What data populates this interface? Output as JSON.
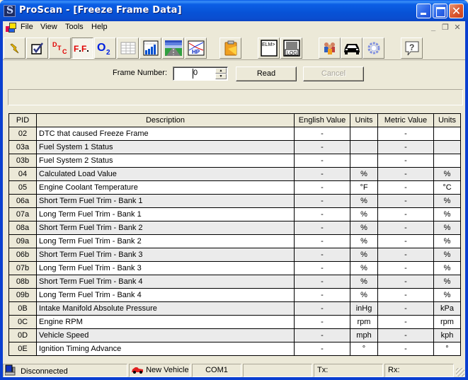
{
  "window": {
    "title": "ProScan - [Freeze Frame Data]",
    "controls": {
      "minimize": "minimize",
      "maximize": "maximize",
      "close": "✕"
    }
  },
  "menu": {
    "items": [
      "File",
      "View",
      "Tools",
      "Help"
    ],
    "mdi_controls": [
      "_",
      "❐",
      "✕"
    ]
  },
  "toolbar": {
    "buttons": [
      {
        "name": "connect",
        "icon": "lightning-icon"
      },
      {
        "name": "diagnostic-check",
        "icon": "checkbox-icon"
      },
      {
        "name": "dtc",
        "icon": "dtc-icon",
        "label": "DTC"
      },
      {
        "name": "freeze-frame",
        "icon": "ff-icon",
        "label": "F.F.",
        "pressed": true
      },
      {
        "name": "o2-sensors",
        "icon": "o2-icon",
        "label": "O2"
      },
      {
        "name": "data-grid",
        "icon": "table-icon"
      },
      {
        "name": "graph",
        "icon": "bar-chart-icon"
      },
      {
        "name": "dashboard",
        "icon": "road-icon"
      },
      {
        "name": "horsepower",
        "icon": "hp-icon",
        "label": "HP"
      },
      {
        "name": "report",
        "icon": "clipboard-icon"
      },
      {
        "name": "elm-terminal",
        "icon": "elm-terminal-icon",
        "label": "ELM>"
      },
      {
        "name": "log",
        "icon": "log-icon",
        "label": "LOG"
      },
      {
        "name": "users",
        "icon": "people-icon"
      },
      {
        "name": "vehicle",
        "icon": "car-icon"
      },
      {
        "name": "settings",
        "icon": "gear-icon"
      },
      {
        "name": "help",
        "icon": "help-icon",
        "label": "?"
      }
    ]
  },
  "frame": {
    "label": "Frame Number:",
    "value": "0",
    "read_label": "Read",
    "cancel_label": "Cancel"
  },
  "table": {
    "columns": [
      "PID",
      "Description",
      "English Value",
      "Units",
      "Metric Value",
      "Units"
    ],
    "rows": [
      {
        "pid": "02",
        "desc": "DTC that caused Freeze Frame",
        "eng": "-",
        "eu": "",
        "met": "-",
        "mu": ""
      },
      {
        "pid": "03a",
        "desc": "Fuel System 1 Status",
        "eng": "-",
        "eu": "",
        "met": "-",
        "mu": ""
      },
      {
        "pid": "03b",
        "desc": "Fuel System 2 Status",
        "eng": "-",
        "eu": "",
        "met": "-",
        "mu": ""
      },
      {
        "pid": "04",
        "desc": "Calculated Load Value",
        "eng": "-",
        "eu": "%",
        "met": "-",
        "mu": "%"
      },
      {
        "pid": "05",
        "desc": "Engine Coolant Temperature",
        "eng": "-",
        "eu": "°F",
        "met": "-",
        "mu": "°C"
      },
      {
        "pid": "06a",
        "desc": "Short Term Fuel Trim - Bank 1",
        "eng": "-",
        "eu": "%",
        "met": "-",
        "mu": "%"
      },
      {
        "pid": "07a",
        "desc": "Long Term Fuel Trim - Bank 1",
        "eng": "-",
        "eu": "%",
        "met": "-",
        "mu": "%"
      },
      {
        "pid": "08a",
        "desc": "Short Term Fuel Trim - Bank 2",
        "eng": "-",
        "eu": "%",
        "met": "-",
        "mu": "%"
      },
      {
        "pid": "09a",
        "desc": "Long Term Fuel Trim - Bank 2",
        "eng": "-",
        "eu": "%",
        "met": "-",
        "mu": "%"
      },
      {
        "pid": "06b",
        "desc": "Short Term Fuel Trim - Bank 3",
        "eng": "-",
        "eu": "%",
        "met": "-",
        "mu": "%"
      },
      {
        "pid": "07b",
        "desc": "Long Term Fuel Trim - Bank 3",
        "eng": "-",
        "eu": "%",
        "met": "-",
        "mu": "%"
      },
      {
        "pid": "08b",
        "desc": "Short Term Fuel Trim - Bank 4",
        "eng": "-",
        "eu": "%",
        "met": "-",
        "mu": "%"
      },
      {
        "pid": "09b",
        "desc": "Long Term Fuel Trim - Bank 4",
        "eng": "-",
        "eu": "%",
        "met": "-",
        "mu": "%"
      },
      {
        "pid": "0B",
        "desc": "Intake Manifold Absolute Pressure",
        "eng": "-",
        "eu": "inHg",
        "met": "-",
        "mu": "kPa"
      },
      {
        "pid": "0C",
        "desc": "Engine RPM",
        "eng": "-",
        "eu": "rpm",
        "met": "-",
        "mu": "rpm"
      },
      {
        "pid": "0D",
        "desc": "Vehicle Speed",
        "eng": "-",
        "eu": "mph",
        "met": "-",
        "mu": "kph"
      },
      {
        "pid": "0E",
        "desc": "Ignition Timing Advance",
        "eng": "-",
        "eu": "°",
        "met": "-",
        "mu": "°"
      }
    ]
  },
  "statusbar": {
    "connection": "Disconnected",
    "vehicle": "New Vehicle",
    "port": "COM1",
    "blank": "",
    "tx": "Tx:",
    "rx": "Rx:"
  }
}
